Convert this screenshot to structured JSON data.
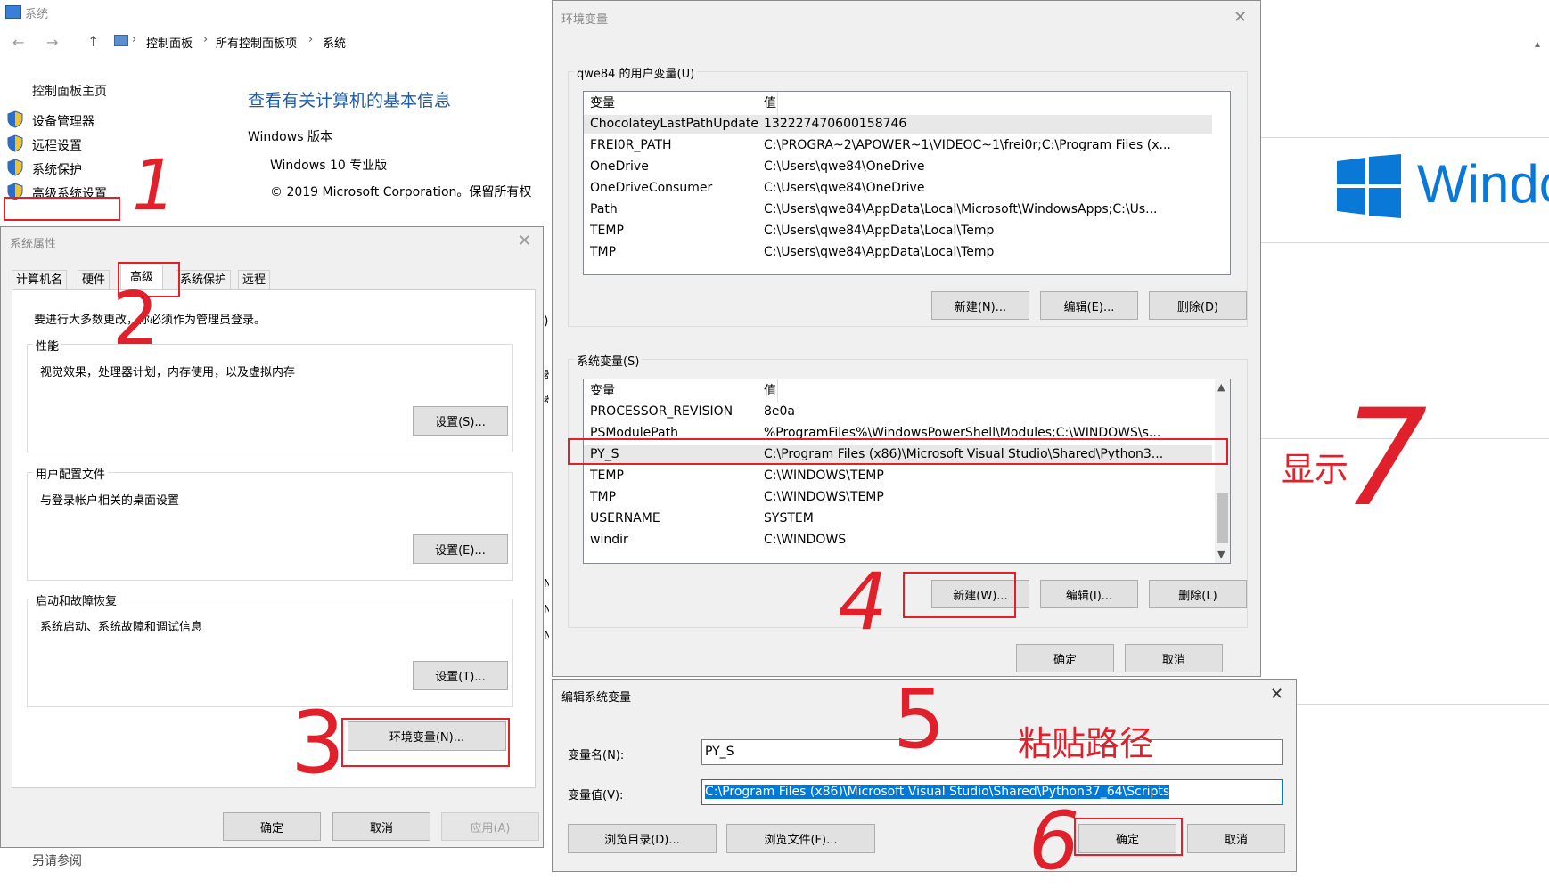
{
  "system_window": {
    "title": "系统",
    "breadcrumb": [
      "控制面板",
      "所有控制面板项",
      "系统"
    ],
    "sidebar_home": "控制面板主页",
    "sidebar_items": [
      "设备管理器",
      "远程设置",
      "系统保护",
      "高级系统设置"
    ],
    "heading": "查看有关计算机的基本信息",
    "edition_label": "Windows 版本",
    "edition": "Windows 10 专业版",
    "copyright": "© 2019 Microsoft Corporation。保留所有权",
    "see_also": "另请参阅",
    "windows_logo_text": "Windo",
    "edge_glyphs": [
      ")",
      "器",
      "器",
      "N",
      "N",
      "N"
    ]
  },
  "sysprops": {
    "title": "系统属性",
    "tabs": [
      "计算机名",
      "硬件",
      "高级",
      "系统保护",
      "远程"
    ],
    "active_tab": "高级",
    "admin_note": "要进行大多数更改，你必须作为管理员登录。",
    "perf_label": "性能",
    "perf_desc": "视觉效果，处理器计划，内存使用，以及虚拟内存",
    "perf_btn": "设置(S)...",
    "profile_label": "用户配置文件",
    "profile_desc": "与登录帐户相关的桌面设置",
    "profile_btn": "设置(E)...",
    "startup_label": "启动和故障恢复",
    "startup_desc": "系统启动、系统故障和调试信息",
    "startup_btn": "设置(T)...",
    "env_btn": "环境变量(N)...",
    "ok": "确定",
    "cancel": "取消",
    "apply": "应用(A)"
  },
  "envvars": {
    "title": "环境变量",
    "user_group": "qwe84 的用户变量(U)",
    "col_var": "变量",
    "col_val": "值",
    "user_rows": [
      {
        "name": "ChocolateyLastPathUpdate",
        "value": "132227470600158746"
      },
      {
        "name": "FREI0R_PATH",
        "value": "C:\\PROGRA~2\\APOWER~1\\VIDEOC~1\\frei0r;C:\\Program Files (x..."
      },
      {
        "name": "OneDrive",
        "value": "C:\\Users\\qwe84\\OneDrive"
      },
      {
        "name": "OneDriveConsumer",
        "value": "C:\\Users\\qwe84\\OneDrive"
      },
      {
        "name": "Path",
        "value": "C:\\Users\\qwe84\\AppData\\Local\\Microsoft\\WindowsApps;C:\\Us..."
      },
      {
        "name": "TEMP",
        "value": "C:\\Users\\qwe84\\AppData\\Local\\Temp"
      },
      {
        "name": "TMP",
        "value": "C:\\Users\\qwe84\\AppData\\Local\\Temp"
      }
    ],
    "user_new": "新建(N)...",
    "user_edit": "编辑(E)...",
    "user_delete": "删除(D)",
    "sys_group": "系统变量(S)",
    "sys_rows": [
      {
        "name": "PROCESSOR_REVISION",
        "value": "8e0a"
      },
      {
        "name": "PSModulePath",
        "value": "%ProgramFiles%\\WindowsPowerShell\\Modules;C:\\WINDOWS\\s..."
      },
      {
        "name": "PY_S",
        "value": "C:\\Program Files (x86)\\Microsoft Visual Studio\\Shared\\Python3..."
      },
      {
        "name": "TEMP",
        "value": "C:\\WINDOWS\\TEMP"
      },
      {
        "name": "TMP",
        "value": "C:\\WINDOWS\\TEMP"
      },
      {
        "name": "USERNAME",
        "value": "SYSTEM"
      },
      {
        "name": "windir",
        "value": "C:\\WINDOWS"
      }
    ],
    "sys_new": "新建(W)...",
    "sys_edit": "编辑(I)...",
    "sys_delete": "删除(L)",
    "ok": "确定",
    "cancel": "取消"
  },
  "editvar": {
    "title": "编辑系统变量",
    "name_label": "变量名(N):",
    "name_value": "PY_S",
    "value_label": "变量值(V):",
    "value_value": "C:\\Program Files (x86)\\Microsoft Visual Studio\\Shared\\Python37_64\\Scripts",
    "browse_dir": "浏览目录(D)...",
    "browse_file": "浏览文件(F)...",
    "ok": "确定",
    "cancel": "取消"
  },
  "annotations": {
    "n1": "1",
    "n2": "2",
    "n3": "3",
    "n4": "4",
    "n5": "5",
    "n6": "6",
    "n7": "7",
    "show_label": "显示",
    "paste_label": "粘贴路径"
  },
  "colors": {
    "annotation_red": "#e0202a",
    "link_blue": "#1e5aa8",
    "win_blue": "#0a78d7",
    "selection": "#0078d7"
  }
}
